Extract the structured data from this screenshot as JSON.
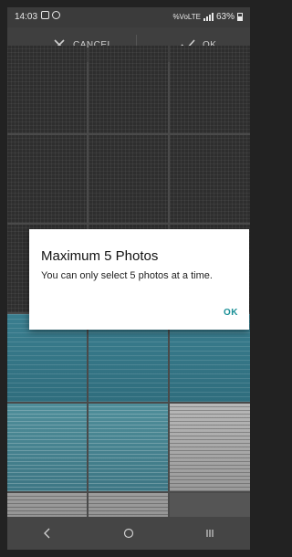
{
  "status_bar": {
    "time": "14:03",
    "network": "%VoLTE",
    "battery": "63%"
  },
  "action_bar": {
    "cancel_label": "CANCEL",
    "ok_label": "OK"
  },
  "grid": {
    "rows": [
      [
        "dark",
        "dark",
        "dark"
      ],
      [
        "dark",
        "dark",
        "dark"
      ],
      [
        "dark",
        "dark",
        "dark"
      ],
      [
        "teal",
        "teal",
        "teal"
      ],
      [
        "receipt-teal",
        "receipt-teal",
        "receipt-light"
      ],
      [
        "receipt-gray",
        "receipt-gray",
        "plain-gray"
      ]
    ]
  },
  "dialog": {
    "title": "Maximum 5 Photos",
    "message": "You can only select 5 photos at a time.",
    "ok_label": "OK"
  },
  "nav_bar": {
    "icons": [
      "back-icon",
      "home-icon",
      "recents-icon"
    ]
  }
}
